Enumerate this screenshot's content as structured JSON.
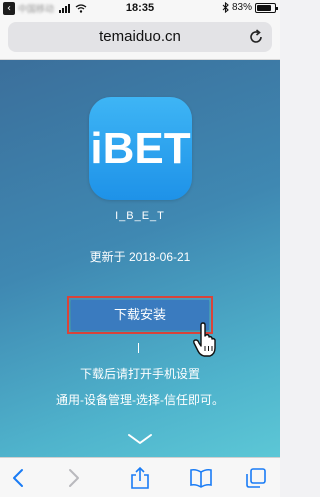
{
  "status_bar": {
    "carrier": "中国移动",
    "time": "18:35",
    "battery_percent": "83%",
    "battery_level": 0.83
  },
  "browser": {
    "url": "temaiduo.cn"
  },
  "app": {
    "icon_text": "iBET",
    "name": "I_B_E_T",
    "updated": "更新于 2018-06-21",
    "install_label": "下载安装",
    "instruction_line1": "下载后请打开手机设置",
    "instruction_line2": "通用-设备管理-选择-信任即可。"
  },
  "colors": {
    "accent": "#3a7bbf",
    "highlight_border": "#d9443a",
    "ios_blue": "#1a7cf5"
  }
}
